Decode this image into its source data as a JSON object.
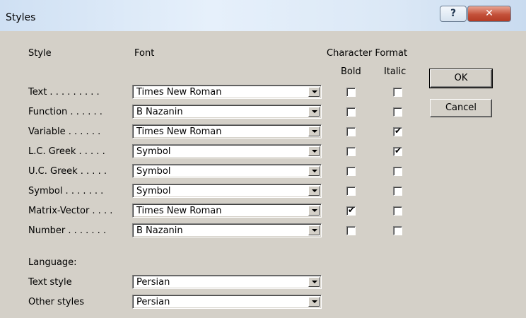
{
  "window": {
    "title": "Styles"
  },
  "titlebar": {
    "help_glyph": "?",
    "close_glyph": "✕"
  },
  "headers": {
    "style": "Style",
    "font": "Font",
    "character_format": "Character Format",
    "bold": "Bold",
    "italic": "Italic"
  },
  "rows": [
    {
      "label": "Text . . . . . . . . .",
      "font": "Times New Roman",
      "bold": false,
      "italic": false
    },
    {
      "label": "Function . . . . . .",
      "font": "B Nazanin",
      "bold": false,
      "italic": false
    },
    {
      "label": "Variable . . . . . .",
      "font": "Times New Roman",
      "bold": false,
      "italic": true
    },
    {
      "label": "L.C. Greek . . . . .",
      "font": "Symbol",
      "bold": false,
      "italic": true
    },
    {
      "label": "U.C. Greek . . . . .",
      "font": "Symbol",
      "bold": false,
      "italic": false
    },
    {
      "label": "Symbol . . . . . . .",
      "font": "Symbol",
      "bold": false,
      "italic": false
    },
    {
      "label": "Matrix-Vector . . . .",
      "font": "Times New Roman",
      "bold": true,
      "italic": false
    },
    {
      "label": "Number . . . . . . .",
      "font": "B Nazanin",
      "bold": false,
      "italic": false
    }
  ],
  "language": {
    "heading": "Language:",
    "text_style_label": "Text style",
    "text_style_value": "Persian",
    "other_styles_label": "Other styles",
    "other_styles_value": "Persian"
  },
  "buttons": {
    "ok": "OK",
    "cancel": "Cancel"
  },
  "check_glyph": "✔"
}
